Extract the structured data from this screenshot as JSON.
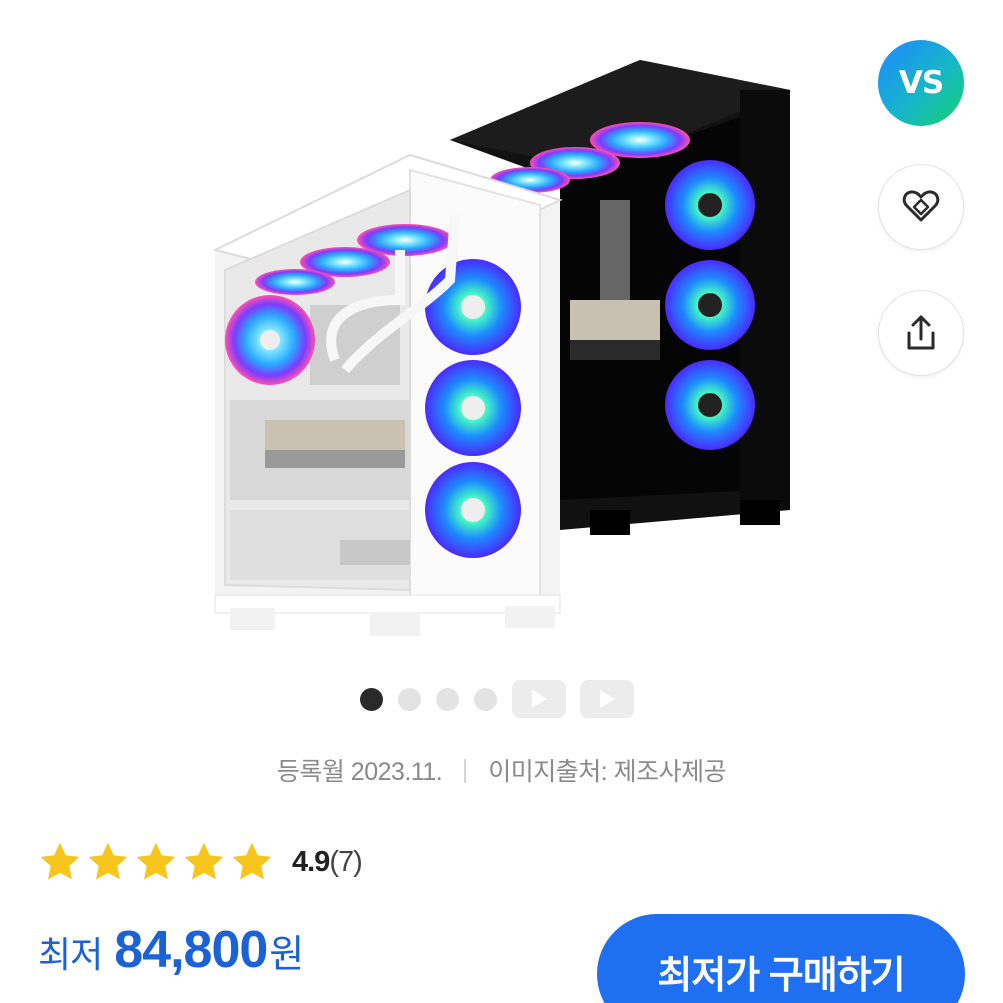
{
  "brand_badge": {
    "label": "VS"
  },
  "icons": {
    "like": "heart-tag-icon",
    "share": "share-icon"
  },
  "gallery": {
    "active_index": 0,
    "image_count": 4,
    "video_count": 2
  },
  "meta": {
    "registered": "등록월 2023.11.",
    "image_source": "이미지출처: 제조사제공"
  },
  "rating": {
    "stars": 5,
    "score": "4.9",
    "count": "(7)"
  },
  "price": {
    "label": "최저",
    "value": "84,800",
    "unit": "원"
  },
  "buy_button": {
    "label": "최저가 구매하기"
  },
  "colors": {
    "accent": "#1f6ff1",
    "price": "#1b62d6",
    "star": "#f7c51b"
  }
}
